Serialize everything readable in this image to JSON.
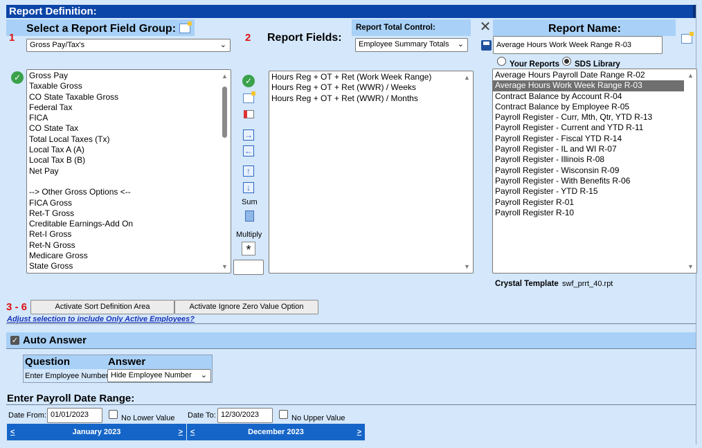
{
  "title": "Report Definition:",
  "section1": {
    "step": "1",
    "label": "Select a Report Field Group:",
    "group_value": "Gross Pay/Tax's",
    "fields": [
      "Gross Pay",
      "Taxable Gross",
      "CO State Taxable Gross",
      "Federal Tax",
      "FICA",
      "CO State Tax",
      "Total Local Taxes (Tx)",
      "Local Tax A (A)",
      "Local Tax B (B)",
      "Net Pay",
      "",
      "--> Other Gross Options <--",
      "FICA Gross",
      "Ret-T Gross",
      "Creditable Earnings-Add On",
      "Ret-I Gross",
      "Ret-N Gross",
      "Medicare Gross",
      "State Gross"
    ]
  },
  "section2": {
    "step": "2",
    "label": "Report Fields:",
    "selected_fields": [
      "Hours Reg + OT + Ret (Work Week Range)",
      "Hours Reg + OT + Ret (WWR) / Weeks",
      "Hours Reg + OT + Ret (WWR) / Months"
    ],
    "sum_label": "Sum",
    "multiply_label": "Multiply",
    "multiply_symbol": "*"
  },
  "total_control": {
    "label": "Report Total Control:",
    "value": "Employee Summary Totals"
  },
  "report_name": {
    "label": "Report Name:",
    "value": "Average Hours Work Week Range R-03",
    "your_reports_label": "Your Reports",
    "sds_library_label": "SDS Library",
    "library": [
      "Average Hours Payroll Date Range R-02",
      "Average Hours Work Week Range R-03",
      "Contract Balance by Account R-04",
      "Contract Balance by Employee R-05",
      "Payroll Register - Curr, Mth, Qtr, YTD R-13",
      "Payroll Register - Current and YTD R-11",
      "Payroll Register - Fiscal YTD R-14",
      "Payroll Register - IL and WI R-07",
      "Payroll Register - Illinois R-08",
      "Payroll Register - Wisconsin R-09",
      "Payroll Register - With Benefits R-06",
      "Payroll Register - YTD R-15",
      "Payroll Register R-01",
      "Payroll Register R-10"
    ],
    "selected_index": 1,
    "crystal_label": "Crystal Template",
    "crystal_value": "swf_prrt_40.rpt"
  },
  "steps36": {
    "step": "3 - 6",
    "sort_button": "Activate Sort Definition Area",
    "ignore_zero_button": "Activate Ignore Zero Value Option",
    "active_link": "Adjust selection to include Only Active Employees?"
  },
  "auto_answer": {
    "label": "Auto Answer",
    "question_header": "Question",
    "answer_header": "Answer",
    "question": "Enter Employee Number:",
    "answer": "Hide Employee Number"
  },
  "date_range": {
    "label": "Enter Payroll Date Range:",
    "from_label": "Date From:",
    "from_value": "01/01/2023",
    "no_lower": "No Lower Value",
    "to_label": "Date To:",
    "to_value": "12/30/2023",
    "no_upper": "No Upper Value",
    "cal_left": "January 2023",
    "cal_right": "December 2023",
    "prev": "<",
    "next": ">"
  }
}
